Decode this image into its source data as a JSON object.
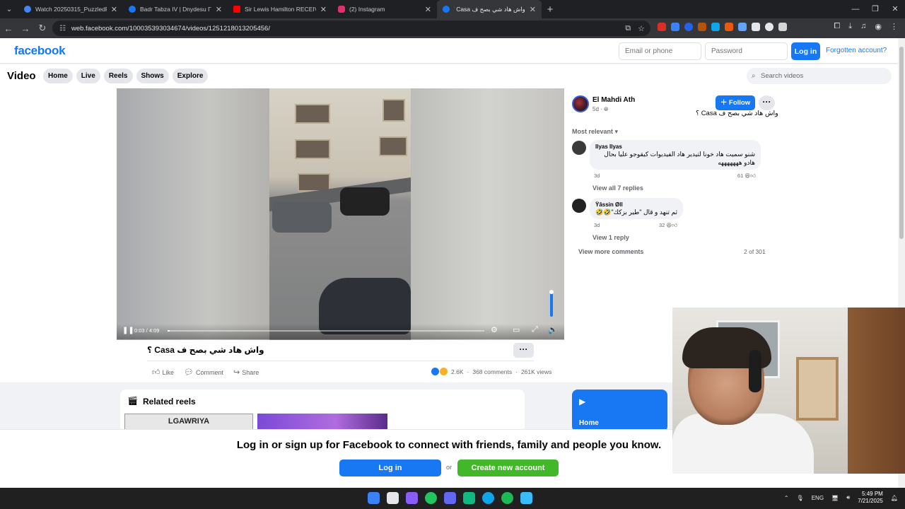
{
  "browser": {
    "tabs": [
      {
        "title": "Watch 20250315_PuzzledPerfe",
        "color": "#4285f4"
      },
      {
        "title": "Badr Tabza IV | Dnydesu Γ| Fa",
        "color": "#1877f2"
      },
      {
        "title": "Sir Lewis Hamilton RECEIVES K",
        "color": "#ff0000"
      },
      {
        "title": "(2) Instagram",
        "color": "#e1306c"
      },
      {
        "title": "واش هاد شي بصح ف Casa ؟",
        "color": "#1877f2",
        "active": true
      }
    ],
    "url": "web.facebook.com/100035393034674/videos/1251218013205456/"
  },
  "header": {
    "logo": "facebook",
    "email_placeholder": "Email or phone",
    "password_placeholder": "Password",
    "login_label": "Log in",
    "forgot_label": "Forgotten account?"
  },
  "subnav": {
    "title": "Video",
    "pills": [
      "Home",
      "Live",
      "Reels",
      "Shows",
      "Explore"
    ],
    "search_placeholder": "Search videos"
  },
  "video": {
    "time": "0:03 / 4:09",
    "progress_fraction": 0.006
  },
  "post": {
    "title": "واش هاد شي بصح ف Casa ؟",
    "actions": [
      "Like",
      "Comment",
      "Share"
    ],
    "reactions": "2.6K",
    "comments": "368 comments",
    "views": "261K views"
  },
  "author": {
    "name": "El Mahdi Ath",
    "age": "5d",
    "follow_label": "Follow",
    "caption": "واش هاد شي بصح ف Casa ؟"
  },
  "comments_panel": {
    "sort_label": "Most relevant",
    "comments": [
      {
        "name": "Ilyas Ilyas",
        "text_line1": "شنو سميت هاد خونا لتيدير هاد الفيديوات كيقوجو عليا بحال",
        "text_line2": "هادو هههههههه",
        "time": "3d",
        "reactions": "61",
        "replies_label": "View all 7 replies"
      },
      {
        "name": "Ÿâssin Øll",
        "text_line1": "ثم تنهد و قال \"طير بزكك\"🤣🤣",
        "time": "3d",
        "reactions": "32",
        "replies_label": "View 1 reply"
      }
    ],
    "more_label": "View more comments",
    "count_label": "2 of 301"
  },
  "related": {
    "title": "Related reels",
    "reel1_label": "LGAWRIYA",
    "side_label": "Home"
  },
  "banner": {
    "text": "Log in or sign up for Facebook to connect with friends, family and people you know.",
    "login_label": "Log in",
    "or_label": "or",
    "create_label": "Create new account"
  },
  "taskbar": {
    "lang": "ENG",
    "time": "5:49 PM",
    "date": "7/21/2025"
  },
  "colors": {
    "fb_blue": "#1877f2",
    "create_green": "#42b72a"
  }
}
